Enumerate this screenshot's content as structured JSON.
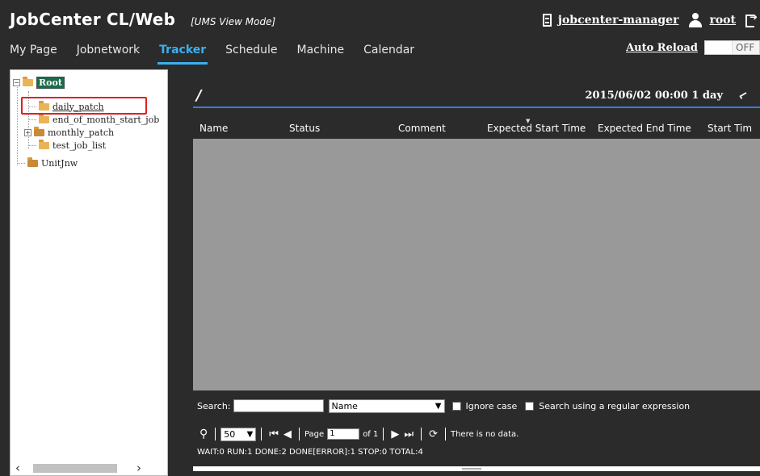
{
  "app": {
    "title": "JobCenter CL/Web",
    "mode": "[UMS View Mode]",
    "server": "jobcenter-manager",
    "user": "root"
  },
  "nav": {
    "items": [
      "My Page",
      "Jobnetwork",
      "Tracker",
      "Schedule",
      "Machine",
      "Calendar"
    ],
    "active": "Tracker"
  },
  "autoreload": {
    "label": "Auto Reload",
    "state": "OFF"
  },
  "tree": {
    "root": "Root",
    "items": [
      "daily_patch",
      "end_of_month_start_job",
      "monthly_patch",
      "test_job_list"
    ],
    "unit": "UnitJnw"
  },
  "main": {
    "path": "/",
    "date": "2015/06/02 00:00 1 day",
    "columns": [
      "Name",
      "Status",
      "Comment",
      "Expected Start Time",
      "Expected End Time",
      "Start Tim"
    ]
  },
  "search": {
    "label": "Search:",
    "field_value": "",
    "select_value": "Name",
    "ignore_case": "Ignore case",
    "regex": "Search using a regular expression"
  },
  "pager": {
    "page_size": "50",
    "page_label": "Page",
    "page_value": "1",
    "of_label": "of 1",
    "no_data": "There is no data."
  },
  "stats": "WAIT:0  RUN:1  DONE:2  DONE[ERROR]:1  STOP:0  TOTAL:4",
  "colors": {
    "accent": "#3ab0f0",
    "underline": "#3a7bd5",
    "highlight": "#e02020"
  }
}
